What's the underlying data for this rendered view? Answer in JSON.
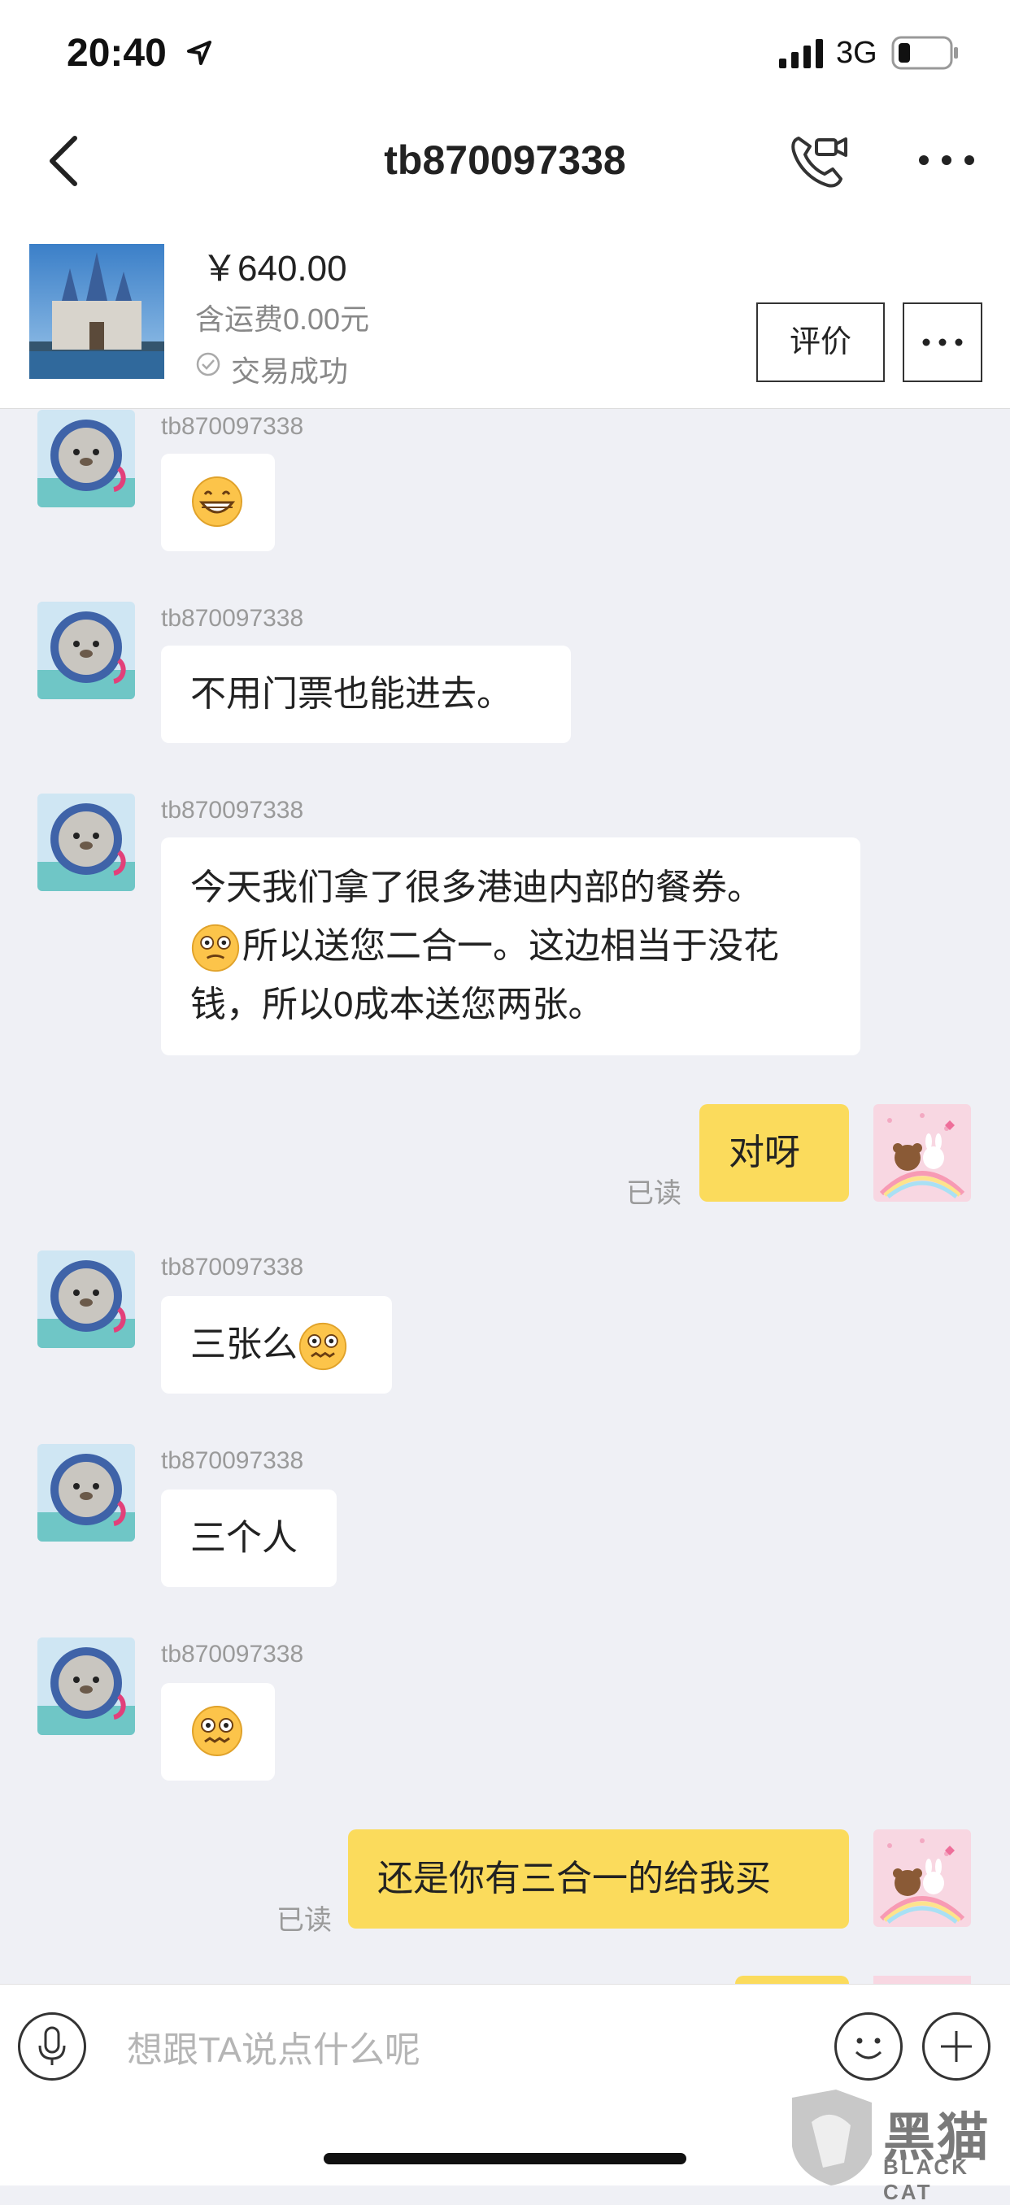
{
  "status_bar": {
    "time": "20:40",
    "network": "3G"
  },
  "header": {
    "title": "tb870097338"
  },
  "order": {
    "price": "￥640.00",
    "shipping": "含运费0.00元",
    "status": "交易成功",
    "rate_button": "评价"
  },
  "messages": [
    {
      "sender": "tb870097338",
      "text": ""
    },
    {
      "sender": "tb870097338",
      "text": "不用门票也能进去。"
    },
    {
      "sender": "tb870097338",
      "line1": "今天我们拿了很多港迪内部的餐券。",
      "line2": "所以送您二合一。这边相当于没花",
      "line3": "钱，所以0成本送您两张。"
    },
    {
      "sender": "me",
      "text": "对呀",
      "read": "已读"
    },
    {
      "sender": "tb870097338",
      "text": "三张么"
    },
    {
      "sender": "tb870097338",
      "text": "三个人"
    },
    {
      "sender": "tb870097338",
      "text": ""
    },
    {
      "sender": "me",
      "text": "还是你有三合一的给我买",
      "read": "已读"
    }
  ],
  "input": {
    "placeholder": "想跟TA说点什么呢"
  },
  "watermark": {
    "text": "黑猫",
    "sub": "BLACK CAT"
  },
  "colors": {
    "my_bubble": "#fbdb5c",
    "background": "#eff0f5"
  }
}
